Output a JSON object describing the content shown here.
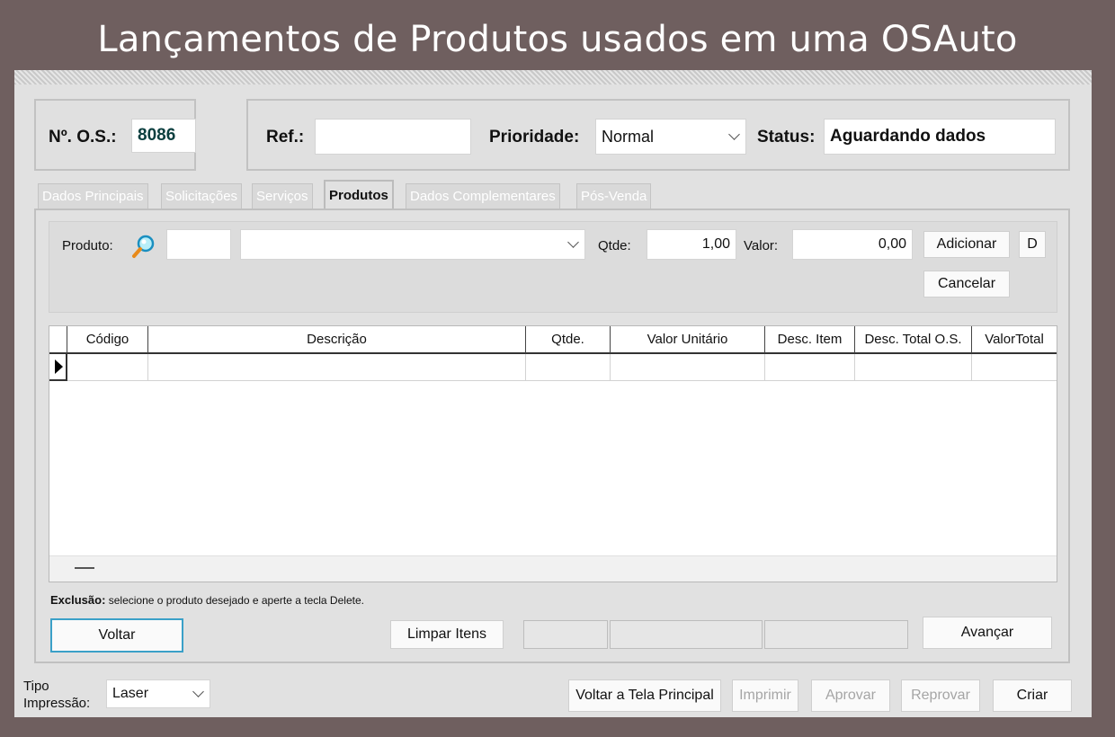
{
  "banner": {
    "title": "Lançamentos de Produtos usados em uma OSAuto"
  },
  "header": {
    "os_label": "Nº. O.S.:",
    "os_value": "8086",
    "ref_label": "Ref.:",
    "ref_value": "",
    "priority_label": "Prioridade:",
    "priority_value": "Normal",
    "status_label": "Status:",
    "status_value": "Aguardando dados"
  },
  "tabs": [
    "Dados Principais",
    "Solicitações",
    "Serviços",
    "Produtos",
    "Dados Complementares",
    "Pós-Venda"
  ],
  "active_tab": "Produtos",
  "product_form": {
    "product_label": "Produto:",
    "product_code": "",
    "product_desc": "",
    "qty_label": "Qtde:",
    "qty_value": "1,00",
    "value_label": "Valor:",
    "value_value": "0,00",
    "add_label": "Adicionar",
    "d_label": "D",
    "cancel_label": "Cancelar"
  },
  "grid": {
    "columns": [
      "Código",
      "Descrição",
      "Qtde.",
      "Valor Unitário",
      "Desc. Item",
      "Desc. Total O.S.",
      "ValorTotal"
    ],
    "rows": []
  },
  "note": {
    "bold": "Exclusão:",
    "text": " selecione o produto desejado e aperte a tecla Delete."
  },
  "panel_buttons": {
    "back": "Voltar",
    "clear": "Limpar Itens",
    "next": "Avançar"
  },
  "footer": {
    "print_type_label_1": "Tipo",
    "print_type_label_2": "Impressão:",
    "print_type_value": "Laser",
    "main_screen": "Voltar a Tela Principal",
    "print": "Imprimir",
    "approve": "Aprovar",
    "reject": "Reprovar",
    "create": "Criar"
  },
  "colors": {
    "background": "#6f5f5f",
    "window": "#e1e1e1",
    "focus_border": "#3aa0c8"
  },
  "icons": {
    "product_search": "search-magnifier-icon"
  }
}
